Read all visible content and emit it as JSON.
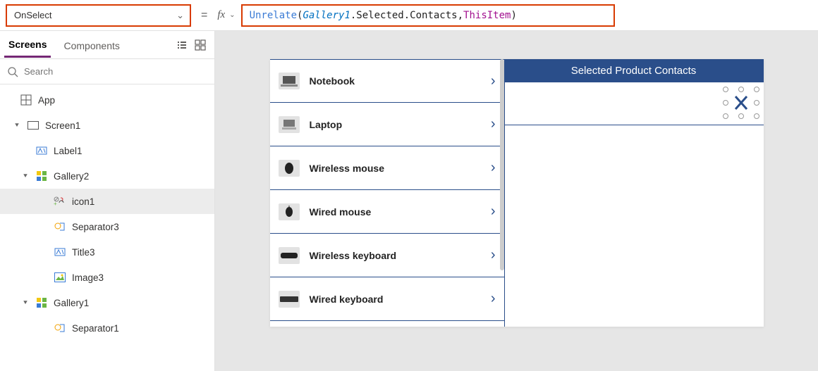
{
  "formula_bar": {
    "property": "OnSelect",
    "formula": {
      "func": "Unrelate",
      "open": "( ",
      "gallery": "Gallery1",
      "prop_chain": ".Selected.Contacts, ",
      "kw": "ThisItem",
      "close": " )"
    }
  },
  "tabs": {
    "screens": "Screens",
    "components": "Components"
  },
  "search": {
    "placeholder": "Search"
  },
  "tree": {
    "app": "App",
    "screen1": "Screen1",
    "label1": "Label1",
    "gallery2": "Gallery2",
    "icon1": "icon1",
    "separator3": "Separator3",
    "title3": "Title3",
    "image3": "Image3",
    "gallery1": "Gallery1",
    "separator1": "Separator1"
  },
  "canvas": {
    "products": [
      "Notebook",
      "Laptop",
      "Wireless mouse",
      "Wired mouse",
      "Wireless keyboard",
      "Wired keyboard"
    ],
    "contacts_header": "Selected Product Contacts"
  }
}
